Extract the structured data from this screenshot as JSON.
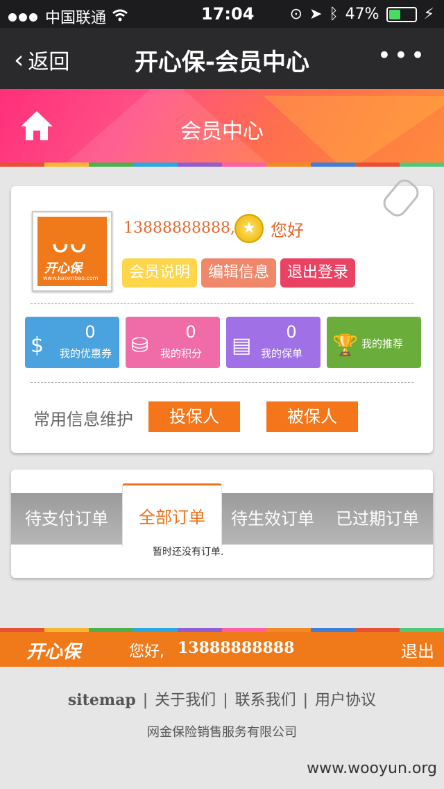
{
  "status_bar": {
    "carrier": "中国联通",
    "time": "17:04",
    "battery_percent": "47%",
    "battery_level": 0.47
  },
  "nav": {
    "back_label": "返回",
    "title": "开心保-会员中心",
    "more_label": "•••"
  },
  "banner": {
    "title": "会员中心"
  },
  "colors": {
    "stripe": [
      "#e94f37",
      "#f7b733",
      "#4cb050",
      "#2aa8e0",
      "#8f5ed0",
      "#ff5fa0",
      "#f08a24",
      "#3f7fd8",
      "#e94f37",
      "#50c878"
    ]
  },
  "profile": {
    "logo_brand": "开心保",
    "logo_url": "www.kaixinbao.com",
    "phone": "13888888888,",
    "greeting": "您好",
    "buttons": {
      "member_info": "会员说明",
      "edit_info": "编辑信息",
      "logout": "退出登录"
    }
  },
  "stats": [
    {
      "value": "0",
      "label": "我的优惠券",
      "icon": "dollar-coin-icon"
    },
    {
      "value": "0",
      "label": "我的积分",
      "icon": "coin-stack-icon"
    },
    {
      "value": "0",
      "label": "我的保单",
      "icon": "scroll-icon"
    },
    {
      "value": "",
      "label": "我的推荐",
      "icon": "trophy-icon"
    }
  ],
  "maintenance": {
    "label": "常用信息维护",
    "policy_holder": "投保人",
    "insured": "被保人"
  },
  "orders": {
    "tabs": [
      "待支付订单",
      "全部订单",
      "待生效订单",
      "已过期订单"
    ],
    "active_tab": "全部订单",
    "empty_text": "暂时还没有订单."
  },
  "footer": {
    "brand": "开心保",
    "greeting": "您好,",
    "phone": "13888888888",
    "exit": "退出",
    "links": [
      "sitemap",
      "关于我们",
      "联系我们",
      "用户协议"
    ],
    "company": "网金保险销售服务有限公司"
  },
  "watermark": "www.wooyun.org"
}
